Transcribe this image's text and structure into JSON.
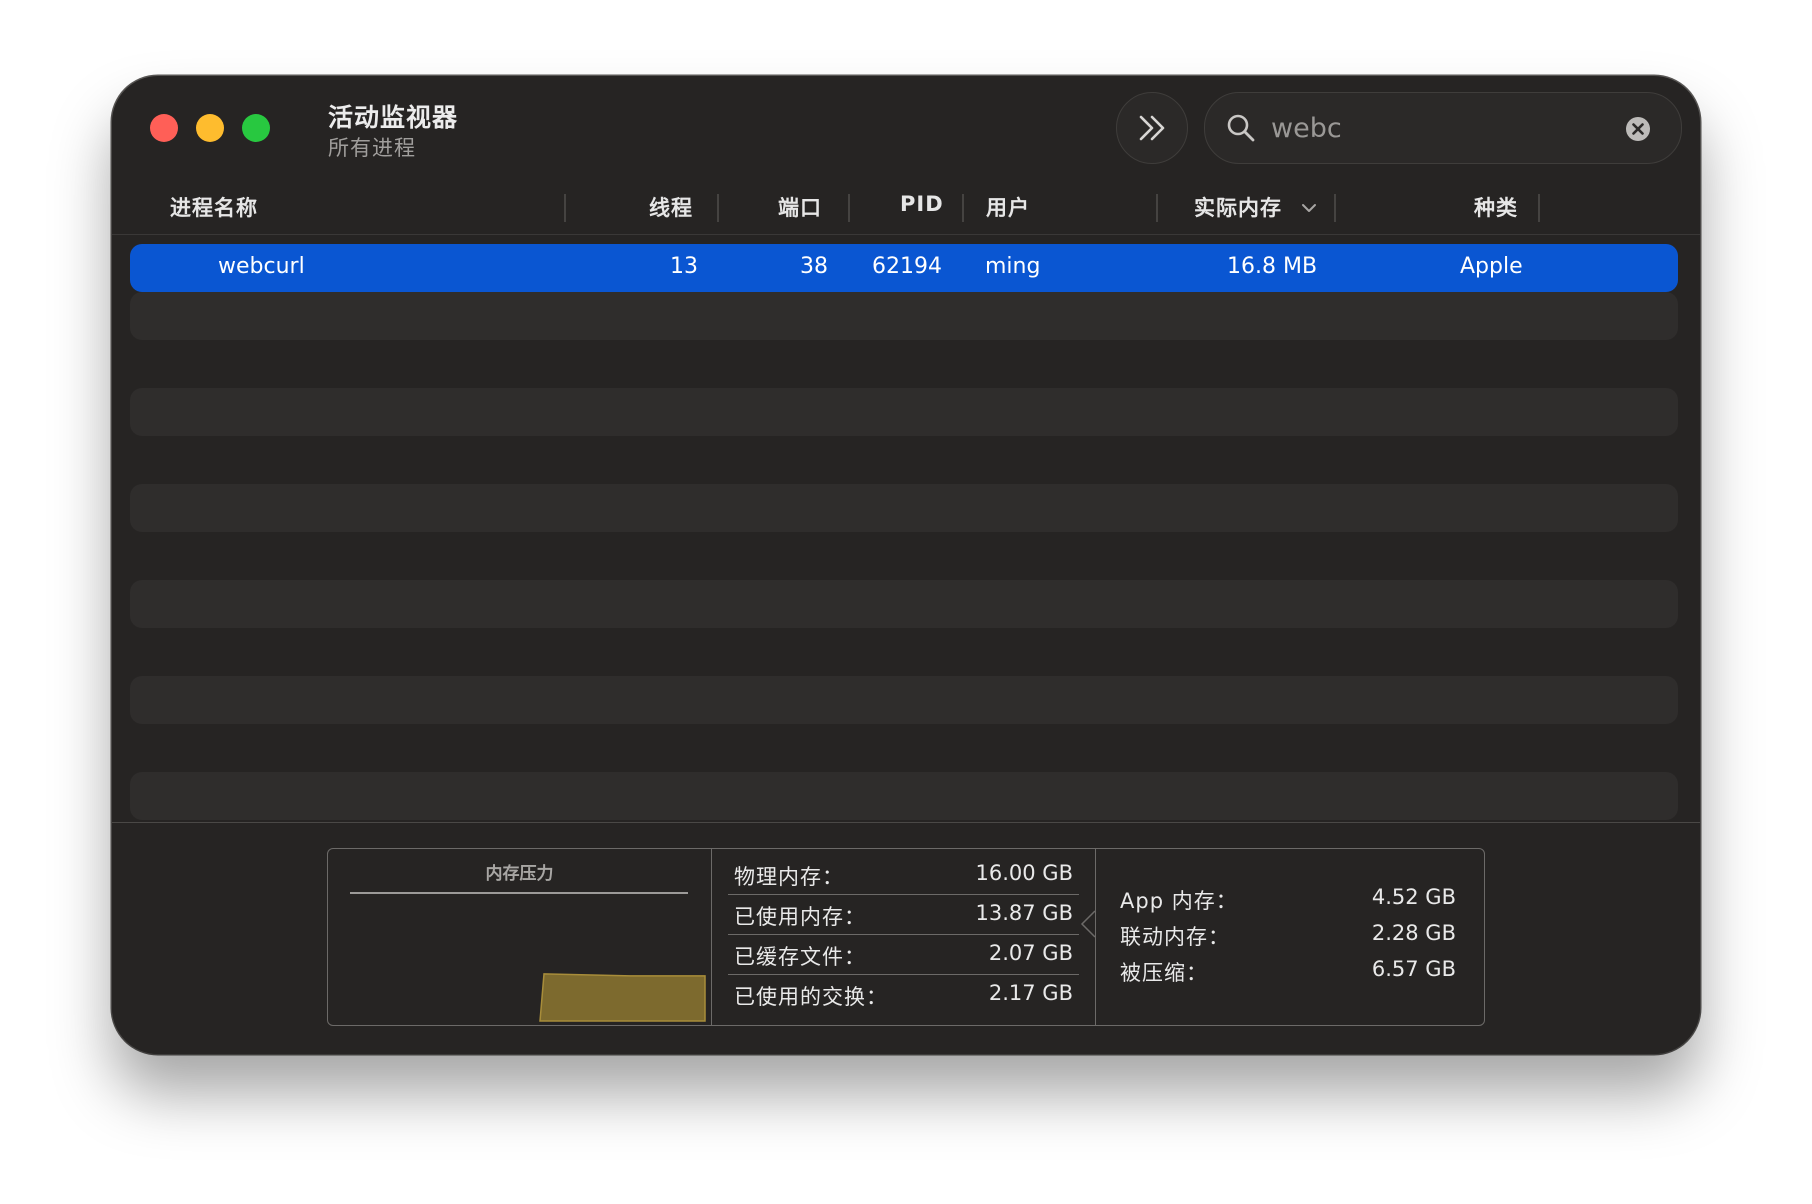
{
  "window": {
    "title": "活动监视器",
    "subtitle": "所有进程"
  },
  "search": {
    "value": "webc"
  },
  "columns": {
    "name": "进程名称",
    "threads": "线程",
    "ports": "端口",
    "pid": "PID",
    "user": "用户",
    "real_memory": "实际内存",
    "kind": "种类"
  },
  "rows": [
    {
      "name": "webcurl",
      "threads": "13",
      "ports": "38",
      "pid": "62194",
      "user": "ming",
      "real_memory": "16.8 MB",
      "kind": "Apple",
      "selected": true
    }
  ],
  "memory_pressure": {
    "title": "内存压力",
    "level": 0.38,
    "color": "#7d6a2e"
  },
  "memory_stats": {
    "physical": {
      "label": "物理内存：",
      "value": "16.00 GB"
    },
    "used": {
      "label": "已使用内存：",
      "value": "13.87 GB"
    },
    "cached": {
      "label": "已缓存文件：",
      "value": "2.07 GB"
    },
    "swap": {
      "label": "已使用的交换：",
      "value": "2.17 GB"
    }
  },
  "memory_breakdown": {
    "app": {
      "label": "App 内存：",
      "value": "4.52 GB"
    },
    "wired": {
      "label": "联动内存：",
      "value": "2.28 GB"
    },
    "compressed": {
      "label": "被压缩：",
      "value": "6.57 GB"
    }
  },
  "colors": {
    "window_bg": "#262423",
    "selection": "#0a56d2",
    "close": "#ff5f57",
    "minimize": "#febc2e",
    "zoom": "#28c840"
  }
}
